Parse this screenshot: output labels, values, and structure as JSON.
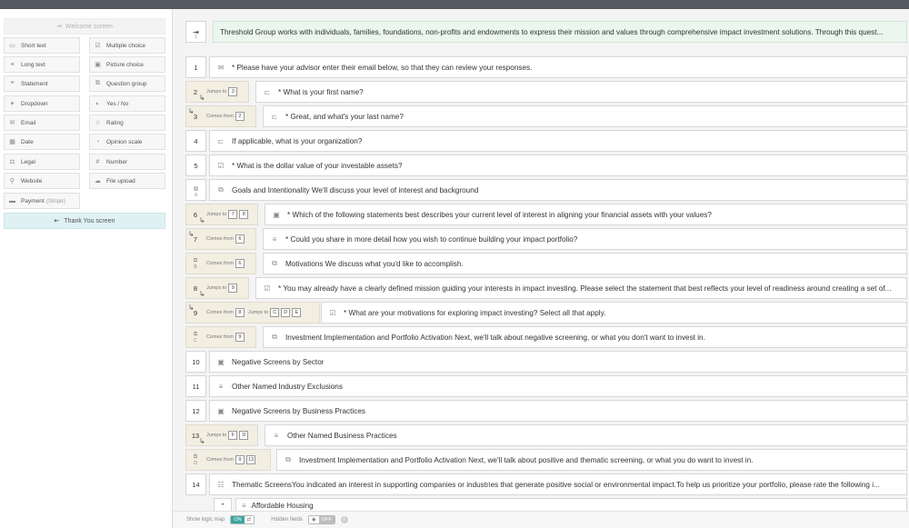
{
  "sidebar": {
    "welcome_label": "Welcome screen",
    "field_types": [
      {
        "label": "Short text",
        "icon": "short-text-icon"
      },
      {
        "label": "Multiple choice",
        "icon": "multiple-choice-icon"
      },
      {
        "label": "Long text",
        "icon": "long-text-icon"
      },
      {
        "label": "Picture choice",
        "icon": "picture-choice-icon"
      },
      {
        "label": "Statement",
        "icon": "statement-icon"
      },
      {
        "label": "Question group",
        "icon": "question-group-icon"
      },
      {
        "label": "Dropdown",
        "icon": "dropdown-icon"
      },
      {
        "label": "Yes / No",
        "icon": "yes-no-icon"
      },
      {
        "label": "Email",
        "icon": "email-icon"
      },
      {
        "label": "Rating",
        "icon": "rating-icon"
      },
      {
        "label": "Date",
        "icon": "date-icon"
      },
      {
        "label": "Opinion scale",
        "icon": "opinion-scale-icon"
      },
      {
        "label": "Legal",
        "icon": "legal-icon"
      },
      {
        "label": "Number",
        "icon": "number-icon"
      },
      {
        "label": "Website",
        "icon": "website-icon"
      },
      {
        "label": "File upload",
        "icon": "file-upload-icon"
      }
    ],
    "payment_label": "Payment",
    "payment_suffix": "(Stripe)",
    "thanks_label": "Thank You screen"
  },
  "welcome_card": {
    "num": "1",
    "text": "Threshold Group works with individuals, families, foundations, non-profits and endowments to express their mission and values through comprehensive impact investment solutions. Through this quest..."
  },
  "questions": [
    {
      "num": "1",
      "text": "* Please have your advisor enter their email below, so that they can review your responses."
    },
    {
      "num": "2",
      "logic": "Jumps to",
      "boxes": [
        "3"
      ],
      "text": "* What is your first name?"
    },
    {
      "num": "3",
      "logic": "Comes from",
      "boxes": [
        "2"
      ],
      "text": "* Great, and what's your last name?"
    },
    {
      "num": "4",
      "text": "If applicable, what is your organization?"
    },
    {
      "num": "5",
      "text": "* What is the dollar value of your investable assets?"
    },
    {
      "num": "A",
      "text": "Goals and Intentionality We'll discuss your level of interest and background"
    },
    {
      "num": "6",
      "logic": "Jumps to",
      "boxes": [
        "7",
        "8"
      ],
      "text": "* Which of the following statements best describes your current level of interest in aligning your financial assets with your values?"
    },
    {
      "num": "7",
      "logic": "Comes from",
      "boxes": [
        "6"
      ],
      "text": "* Could you share in more detail how you wish to continue building your impact portfolio?"
    },
    {
      "num": "B",
      "logic": "Comes from",
      "boxes": [
        "6"
      ],
      "text": "Motivations We discuss what you'd like to accomplish."
    },
    {
      "num": "8",
      "logic": "Jumps to",
      "boxes": [
        "9"
      ],
      "text": "* You may already have a clearly defined mission guiding your interests in impact investing. Please select the statement that best reflects your level of readiness around creating a set of..."
    },
    {
      "num": "9",
      "logic": "Comes from",
      "boxes": [
        "8"
      ],
      "logic2": "Jumps to",
      "boxes2": [
        "C",
        "D",
        "E"
      ],
      "text": "* What are your motivations for exploring impact investing? Select all that apply."
    },
    {
      "num": "C",
      "logic": "Comes from",
      "boxes": [
        "9"
      ],
      "text": "Investment Implementation and Portfolio Activation Next, we'll talk about negative screening, or what you don't want to invest in."
    },
    {
      "num": "10",
      "text": "Negative Screens by Sector"
    },
    {
      "num": "11",
      "text": "Other Named Industry Exclusions"
    },
    {
      "num": "12",
      "text": "Negative Screens by Business Practices"
    },
    {
      "num": "13",
      "logic": "Jumps to",
      "boxes": [
        "F",
        "D"
      ],
      "text": "Other Named Business Practices"
    },
    {
      "num": "D",
      "logic": "Comes from",
      "boxes": [
        "9",
        "13"
      ],
      "text": "Investment Implementation and Portfolio Activation Next, we'll talk about positive and thematic screening, or what you do want to invest in."
    },
    {
      "num": "14",
      "text": "Thematic ScreensYou indicated an interest in supporting companies or industries that generate positive social or environmental impact.To help us prioritize your portfolio, please rate the following i..."
    }
  ],
  "sub_item": {
    "text": "Affordable Housing"
  },
  "bottom": {
    "logic_map_label": "Show logic map",
    "logic_on": "ON",
    "hidden_fields_label": "Hidden fields",
    "hidden_off": "OFF"
  },
  "colors": {
    "accent": "#3aa6a0",
    "welcome_bg": "#eaf6ee",
    "logic_bg": "#f2eee2",
    "thanks_bg": "#dff1f3"
  }
}
